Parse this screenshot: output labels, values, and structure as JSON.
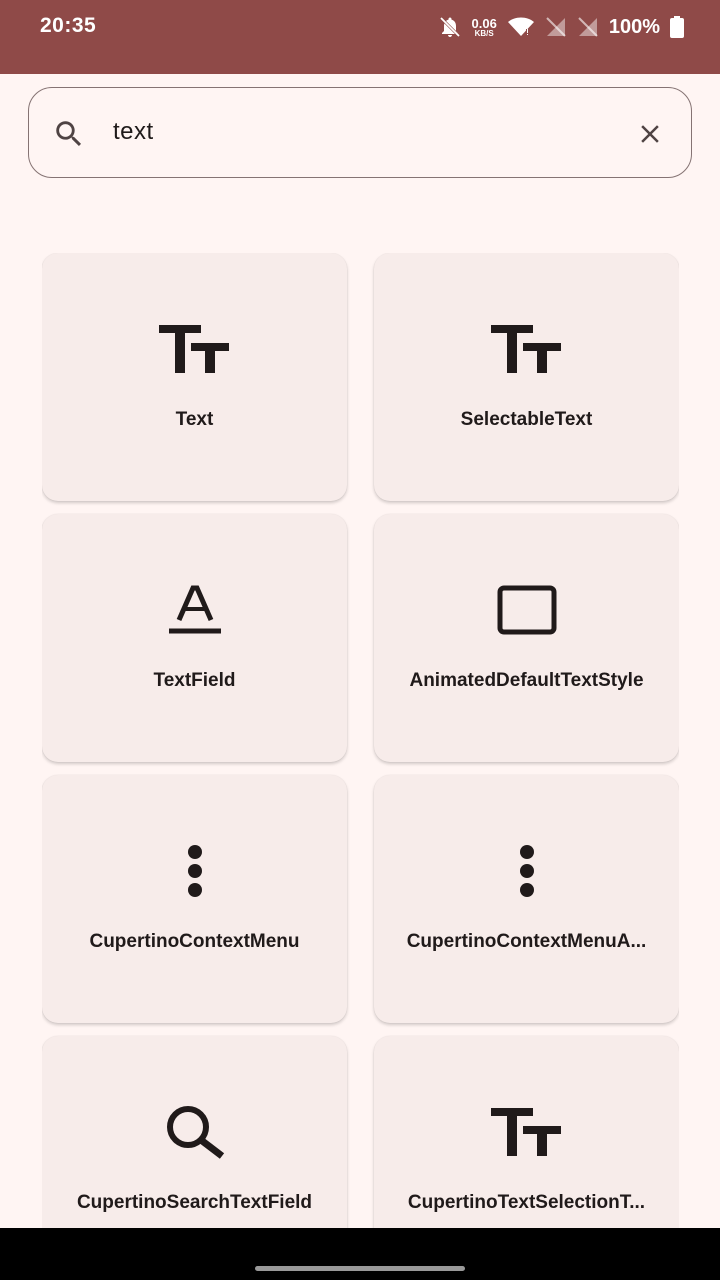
{
  "status_bar": {
    "time": "20:35",
    "net_speed_value": "0.06",
    "net_speed_unit": "KB/S",
    "battery": "100%",
    "icons": [
      "notifications-off-icon",
      "wifi-icon",
      "no-sim-icon",
      "no-sim-icon",
      "battery-full-icon"
    ]
  },
  "search": {
    "value": "text",
    "icon": "search-icon",
    "clear_icon": "close-icon"
  },
  "widgets": [
    {
      "label": "Text",
      "icon": "text-fields-icon"
    },
    {
      "label": "SelectableText",
      "icon": "text-fields-icon"
    },
    {
      "label": "TextField",
      "icon": "text-format-icon"
    },
    {
      "label": "AnimatedDefaultTextStyle",
      "icon": "crop-square-icon"
    },
    {
      "label": "CupertinoContextMenu",
      "icon": "more-vert-icon"
    },
    {
      "label": "CupertinoContextMenuA...",
      "icon": "more-vert-icon"
    },
    {
      "label": "CupertinoSearchTextField",
      "icon": "search-icon"
    },
    {
      "label": "CupertinoTextSelectionT...",
      "icon": "text-fields-icon"
    }
  ],
  "colors": {
    "status_bar": "#8f4a48",
    "background": "#fff5f3",
    "card": "#f7ecea",
    "outline": "#857373",
    "icon": "#201a1a"
  }
}
